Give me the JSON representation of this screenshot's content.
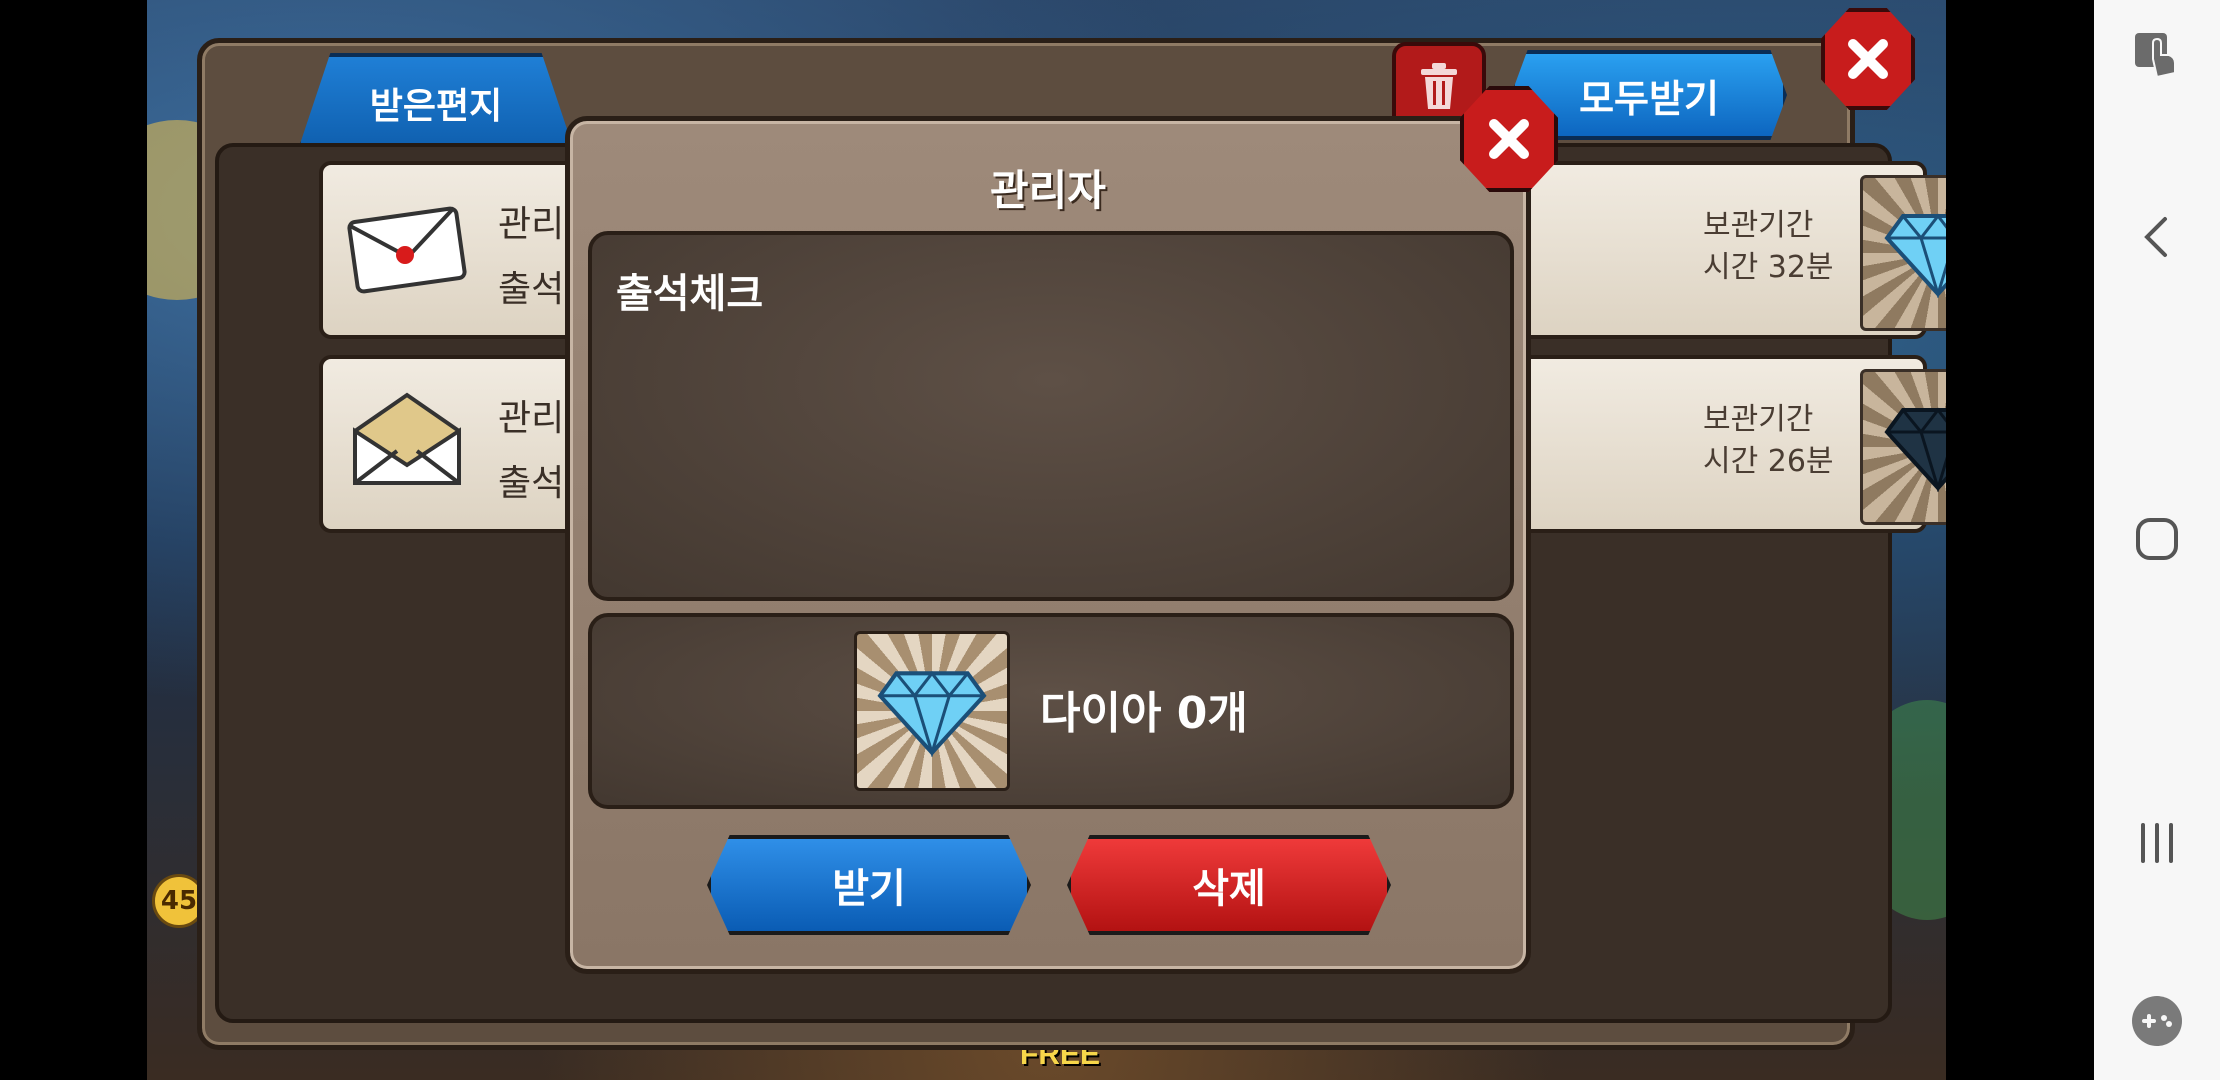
{
  "mailbox": {
    "tab_label": "받은편지",
    "receive_all_label": "모두받기",
    "items": [
      {
        "sender": "관리자",
        "subject": "출석체크",
        "expire_line1": "보관기간",
        "expire_line2": "시간 32분",
        "status": "unread",
        "reward_icon": "diamond-icon"
      },
      {
        "sender": "관리자",
        "subject": "출석체크",
        "expire_line1": "보관기간",
        "expire_line2": "시간 26분",
        "status": "read",
        "reward_icon": "diamond-icon"
      }
    ]
  },
  "dialog": {
    "title": "관리자",
    "body": "출석체크",
    "reward_text": "다이아 0개",
    "receive_label": "받기",
    "delete_label": "삭제"
  },
  "background": {
    "free_label": "FREE",
    "badge_45": "45"
  },
  "colors": {
    "primary_blue": "#0f5fae",
    "danger_red": "#c81c1c",
    "panel_brown": "#5d4d3f",
    "dialog_brown": "#9e8a7a"
  }
}
